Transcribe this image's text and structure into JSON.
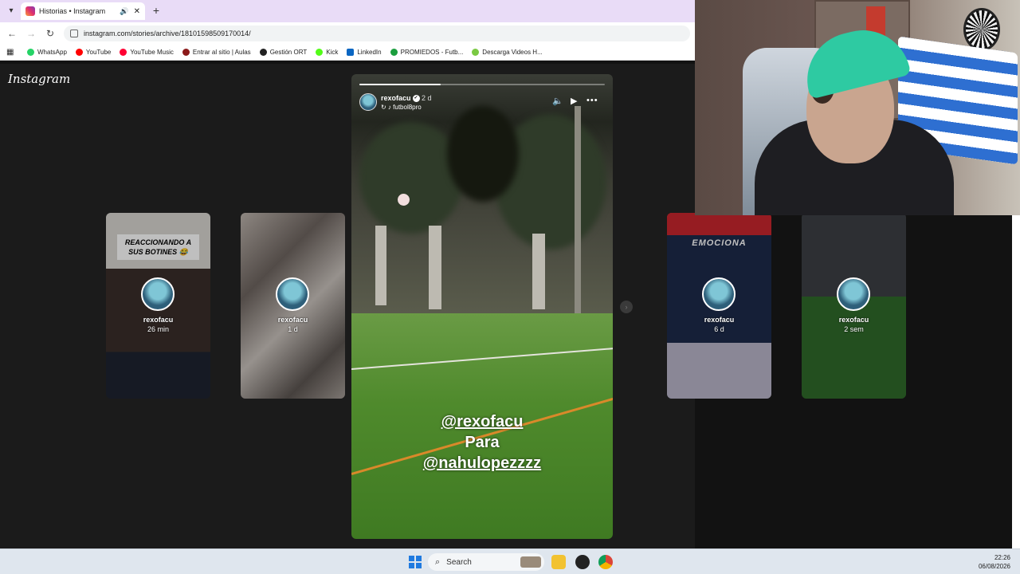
{
  "browser": {
    "tab": {
      "title": "Historias • Instagram"
    },
    "url": "instagram.com/stories/archive/18101598509170014/",
    "bookmarks": [
      {
        "label": "WhatsApp",
        "color": "#25d366"
      },
      {
        "label": "YouTube",
        "color": "#ff0000"
      },
      {
        "label": "YouTube Music",
        "color": "#ff0033"
      },
      {
        "label": "Entrar al sitio | Aulas",
        "color": "#8b1a1a"
      },
      {
        "label": "Gestión ORT",
        "color": "#222222"
      },
      {
        "label": "Kick",
        "color": "#53fc18"
      },
      {
        "label": "LinkedIn",
        "color": "#0a66c2"
      },
      {
        "label": "PROMIEDOS - Futb...",
        "color": "#1b9e3e"
      },
      {
        "label": "Descarga Videos H...",
        "color": "#7ac943"
      }
    ]
  },
  "instagram": {
    "logo": "Instagram",
    "story": {
      "username": "rexofacu",
      "time": "2 d",
      "subline": "futbol8pro",
      "progress": 0.33,
      "mentions": [
        "@rexofacu",
        "Para",
        "@nahulopezzzz"
      ]
    },
    "side_stories": [
      {
        "username": "rexofacu",
        "time": "26 min",
        "caption": "REACCIONANDO A SUS BOTINES 😂"
      },
      {
        "username": "rexofacu",
        "time": "1 d"
      },
      {
        "username": "rexofacu",
        "time": "6 d",
        "caption": "EMOCIONA"
      },
      {
        "username": "rexofacu",
        "time": "2 sem"
      }
    ]
  },
  "taskbar": {
    "search_label": "Search",
    "time": "22:26",
    "date": "06/08/2026"
  }
}
